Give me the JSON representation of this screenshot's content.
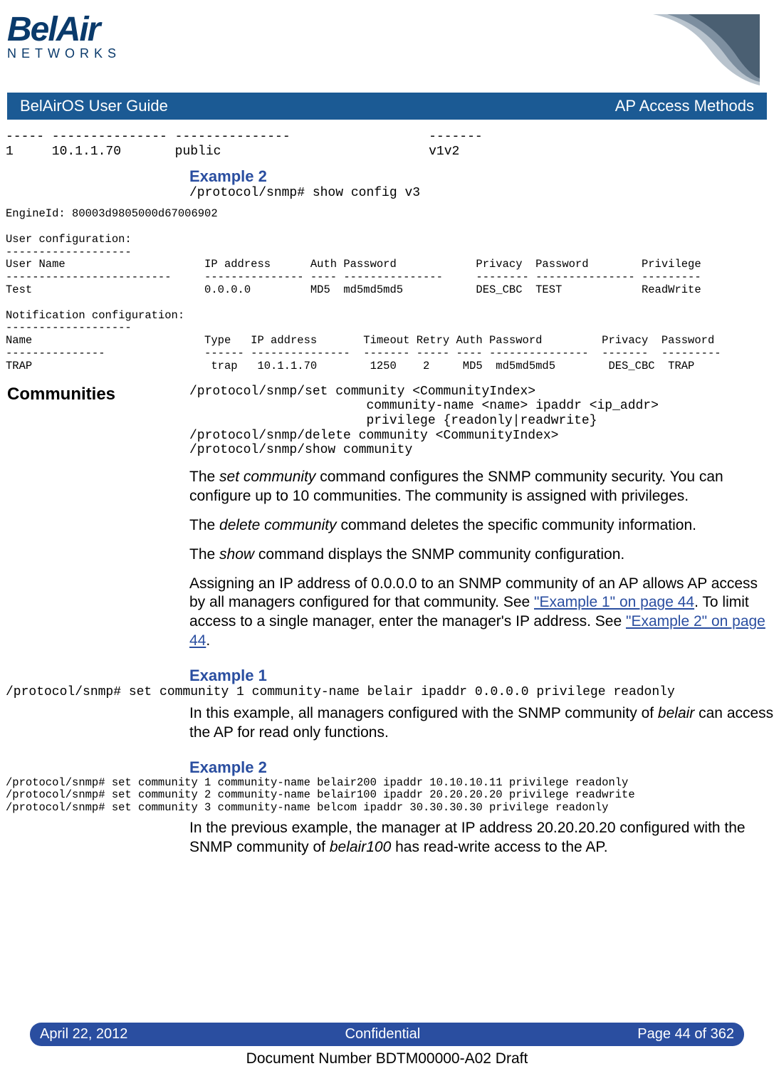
{
  "logo": {
    "top": "BelAir",
    "bottom": "NETWORKS"
  },
  "titlebar": {
    "left": "BelAirOS User Guide",
    "right": "AP Access Methods"
  },
  "pre1": "----- --------------- ---------------                  -------\n1     10.1.1.70       public                           v1v2",
  "ex2a_heading": "Example 2",
  "ex2a_cmd": "/protocol/snmp# show config v3",
  "pre2": "EngineId: 80003d9805000d67006902\n\nUser configuration:\n-------------------\nUser Name                     IP address      Auth Password            Privacy  Password        Privilege\n-------------------------     --------------- ---- ---------------     -------- --------------- ---------\nTest                          0.0.0.0         MD5  md5md5md5           DES_CBC  TEST            ReadWrite\n\nNotification configuration:\n-------------------\nName                          Type   IP address       Timeout Retry Auth Password         Privacy  Password\n---------------               ------ ---------------  ------- ----- ---- ---------------  -------  ---------\nTRAP                           trap   10.1.1.70        1250    2     MD5  md5md5md5        DES_CBC  TRAP",
  "communities": {
    "side": "Communities",
    "syntax": "/protocol/snmp/set community <CommunityIndex>\n                       community-name <name> ipaddr <ip_addr>\n                       privilege {readonly|readwrite}\n/protocol/snmp/delete community <CommunityIndex>\n/protocol/snmp/show community",
    "p1a": "The ",
    "p1b": "set community",
    "p1c": " command configures the SNMP community security. You can configure up to 10 communities. The community is assigned with privileges.",
    "p2a": "The ",
    "p2b": "delete community",
    "p2c": " command deletes the specific community information.",
    "p3a": "The ",
    "p3b": "show",
    "p3c": " command displays the SNMP community configuration.",
    "p4a": "Assigning an IP address of 0.0.0.0 to an SNMP community of an AP allows AP access by all managers configured for that community. See ",
    "p4link1": "\"Example 1\" on page 44",
    "p4b": ". To limit access to a single manager, enter the manager's IP address. See ",
    "p4link2": "\"Example 2\" on page 44",
    "p4c": "."
  },
  "ex1": {
    "heading": "Example 1",
    "cmd": "/protocol/snmp# set community 1 community-name belair ipaddr 0.0.0.0 privilege readonly",
    "p1a": "In this example, all managers configured with the SNMP community of ",
    "p1b": "belair",
    "p1c": " can access the AP for read only functions."
  },
  "ex2b": {
    "heading": "Example 2",
    "cmd": "/protocol/snmp# set community 1 community-name belair200 ipaddr 10.10.10.11 privilege readonly\n/protocol/snmp# set community 2 community-name belair100 ipaddr 20.20.20.20 privilege readwrite\n/protocol/snmp# set community 3 community-name belcom ipaddr 30.30.30.30 privilege readonly",
    "p1a": "In the previous example, the manager at IP address 20.20.20.20 configured with the SNMP community of ",
    "p1b": "belair100",
    "p1c": " has read-write access to the AP."
  },
  "footer": {
    "left": "April 22, 2012",
    "center": "Confidential",
    "right": "Page 44 of 362"
  },
  "docnum": "Document Number BDTM00000-A02 Draft"
}
